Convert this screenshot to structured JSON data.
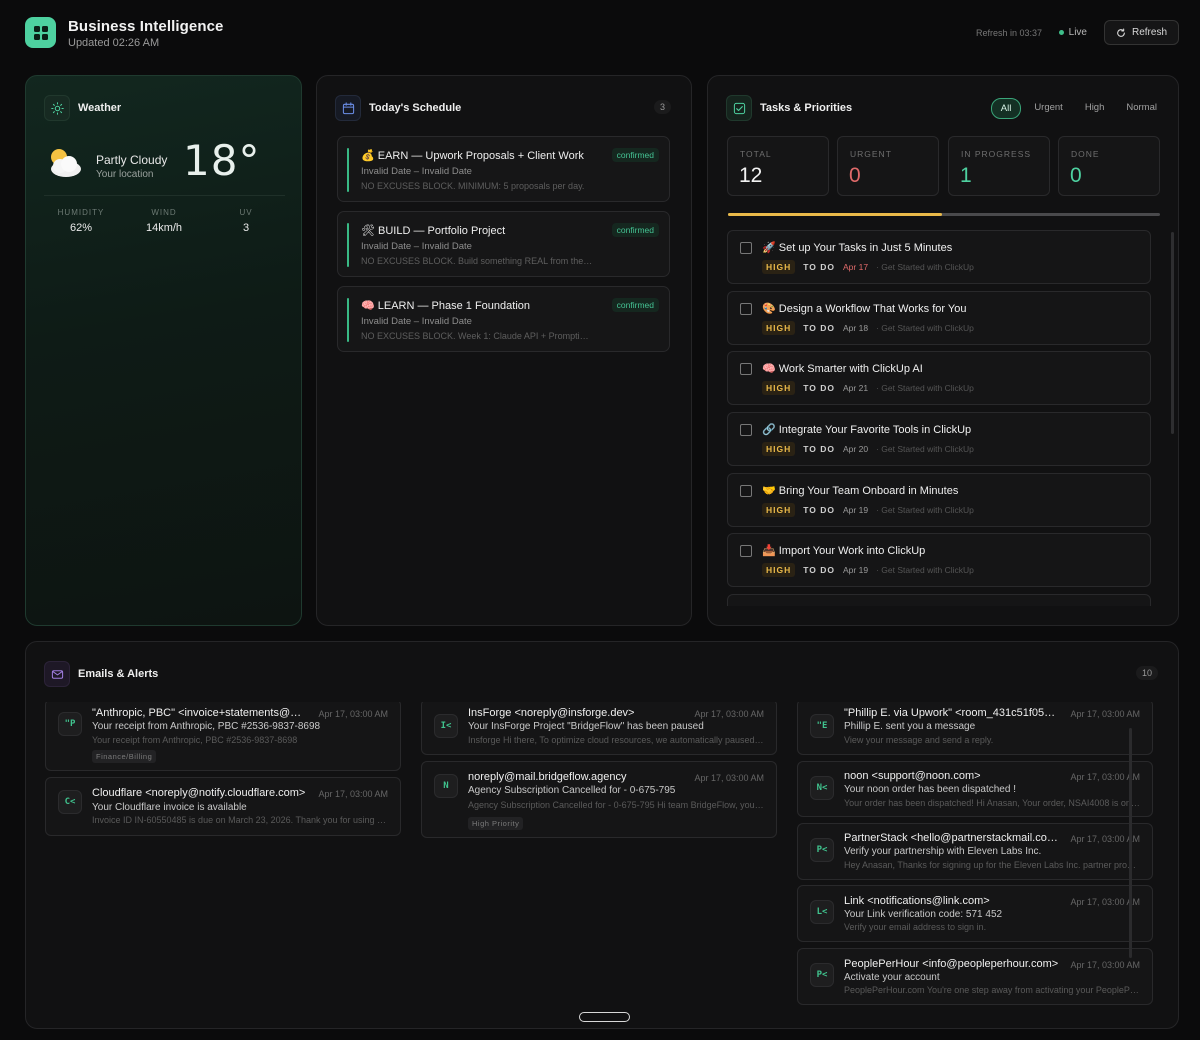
{
  "header": {
    "title": "Business Intelligence",
    "subtitle": "Updated 02:26 AM",
    "refresh_countdown": "Refresh in 03:37",
    "live_label": "Live",
    "refresh_label": "Refresh"
  },
  "colors": {
    "accent": "#4ed1a0",
    "high": "#e9b949",
    "urgent": "#e06a6a",
    "progress": "#3fbf8a"
  },
  "weather": {
    "title": "Weather",
    "condition": "Partly Cloudy",
    "location": "Your location",
    "temperature": "18°",
    "stats": [
      {
        "label": "HUMIDITY",
        "value": "62%"
      },
      {
        "label": "WIND",
        "value": "14km/h"
      },
      {
        "label": "UV",
        "value": "3"
      }
    ]
  },
  "schedule": {
    "title": "Today's Schedule",
    "count": "3",
    "items": [
      {
        "title": "💰 EARN — Upwork Proposals + Client Work",
        "date": "Invalid Date – Invalid Date",
        "desc": "NO EXCUSES BLOCK. MINIMUM: 5 proposals per day.",
        "status": "confirmed"
      },
      {
        "title": "🛠 BUILD — Portfolio Project",
        "date": "Invalid Date – Invalid Date",
        "desc": "NO EXCUSES BLOCK. Build something REAL from the list.",
        "status": "confirmed"
      },
      {
        "title": "🧠 LEARN — Phase 1 Foundation",
        "date": "Invalid Date – Invalid Date",
        "desc": "NO EXCUSES BLOCK. Week 1: Claude API + Prompting basics.",
        "status": "confirmed"
      }
    ]
  },
  "tasks": {
    "title": "Tasks & Priorities",
    "filters": [
      "All",
      "Urgent",
      "High",
      "Normal"
    ],
    "active_filter": "All",
    "stats": [
      {
        "label": "TOTAL",
        "value": "12",
        "color": "#f2f2f2"
      },
      {
        "label": "URGENT",
        "value": "0",
        "color": "#e06a6a"
      },
      {
        "label": "IN PROGRESS",
        "value": "1",
        "color": "#4ed1a0"
      },
      {
        "label": "DONE",
        "value": "0",
        "color": "#4ed1a0"
      }
    ],
    "progress_fraction": 0.495,
    "items": [
      {
        "title": "🚀 Set up Your Tasks in Just 5 Minutes",
        "priority": "HIGH",
        "status": "TO DO",
        "due": "Apr 17",
        "overdue": true,
        "source": "Get Started with ClickUp"
      },
      {
        "title": "🎨 Design a Workflow That Works for You",
        "priority": "HIGH",
        "status": "TO DO",
        "due": "Apr 18",
        "overdue": false,
        "source": "Get Started with ClickUp"
      },
      {
        "title": "🧠 Work Smarter with ClickUp AI",
        "priority": "HIGH",
        "status": "TO DO",
        "due": "Apr 21",
        "overdue": false,
        "source": "Get Started with ClickUp"
      },
      {
        "title": "🔗 Integrate Your Favorite Tools in ClickUp",
        "priority": "HIGH",
        "status": "TO DO",
        "due": "Apr 20",
        "overdue": false,
        "source": "Get Started with ClickUp"
      },
      {
        "title": "🤝 Bring Your Team Onboard in Minutes",
        "priority": "HIGH",
        "status": "TO DO",
        "due": "Apr 19",
        "overdue": false,
        "source": "Get Started with ClickUp"
      },
      {
        "title": "📥 Import Your Work into ClickUp",
        "priority": "HIGH",
        "status": "TO DO",
        "due": "Apr 19",
        "overdue": false,
        "source": "Get Started with ClickUp"
      }
    ]
  },
  "emails": {
    "title": "Emails & Alerts",
    "count": "10",
    "items": [
      {
        "initials": "\"P",
        "from": "\"Anthropic, PBC\" <invoice+statements@mail.anthropic.com>",
        "time": "Apr 17, 03:00 AM",
        "subject": "Your receipt from Anthropic, PBC #2536-9837-8698",
        "preview": "Your receipt from Anthropic, PBC #2536-9837-8698",
        "tag": "Finance/Billing"
      },
      {
        "initials": "C<",
        "from": "Cloudflare <noreply@notify.cloudflare.com>",
        "time": "Apr 17, 03:00 AM",
        "subject": "Your Cloudflare invoice is available",
        "preview": "Invoice ID IN-60550485 is due on March 23, 2026. Thank you for using Cloudflare.",
        "tag": ""
      },
      {
        "initials": "I<",
        "from": "InsForge <noreply@insforge.dev>",
        "time": "Apr 17, 03:00 AM",
        "subject": "Your InsForge Project \"BridgeFlow\" has been paused",
        "preview": "Insforge Hi there, To optimize cloud resources, we automatically paused your project",
        "tag": ""
      },
      {
        "initials": "N",
        "from": "noreply@mail.bridgeflow.agency",
        "time": "Apr 17, 03:00 AM",
        "subject": "Agency Subscription Cancelled for - 0-675-795",
        "preview": "Agency Subscription Cancelled for - 0-675-795 Hi team BridgeFlow, your subscription",
        "tag": "High Priority"
      },
      {
        "initials": "\"E",
        "from": "\"Phillip E. via Upwork\" <room_431c51f05@upwork.com>",
        "time": "Apr 17, 03:00 AM",
        "subject": "Phillip E. sent you a message",
        "preview": "View your message and send a reply.",
        "tag": ""
      },
      {
        "initials": "N<",
        "from": "noon <support@noon.com>",
        "time": "Apr 17, 03:00 AM",
        "subject": "Your noon order has been dispatched !",
        "preview": "Your order has been dispatched! Hi Anasan, Your order, NSAI4008 is on its way",
        "tag": ""
      },
      {
        "initials": "P<",
        "from": "PartnerStack <hello@partnerstackmail.com>",
        "time": "Apr 17, 03:00 AM",
        "subject": "Verify your partnership with Eleven Labs Inc.",
        "preview": "Hey Anasan, Thanks for signing up for the Eleven Labs Inc. partner program",
        "tag": ""
      },
      {
        "initials": "L<",
        "from": "Link <notifications@link.com>",
        "time": "Apr 17, 03:00 AM",
        "subject": "Your Link verification code: 571 452",
        "preview": "Verify your email address to sign in.",
        "tag": ""
      },
      {
        "initials": "P<",
        "from": "PeoplePerHour <info@peopleperhour.com>",
        "time": "Apr 17, 03:00 AM",
        "subject": "Activate your account",
        "preview": "PeoplePerHour.com You're one step away from activating your PeoplePerHour account",
        "tag": ""
      }
    ]
  }
}
